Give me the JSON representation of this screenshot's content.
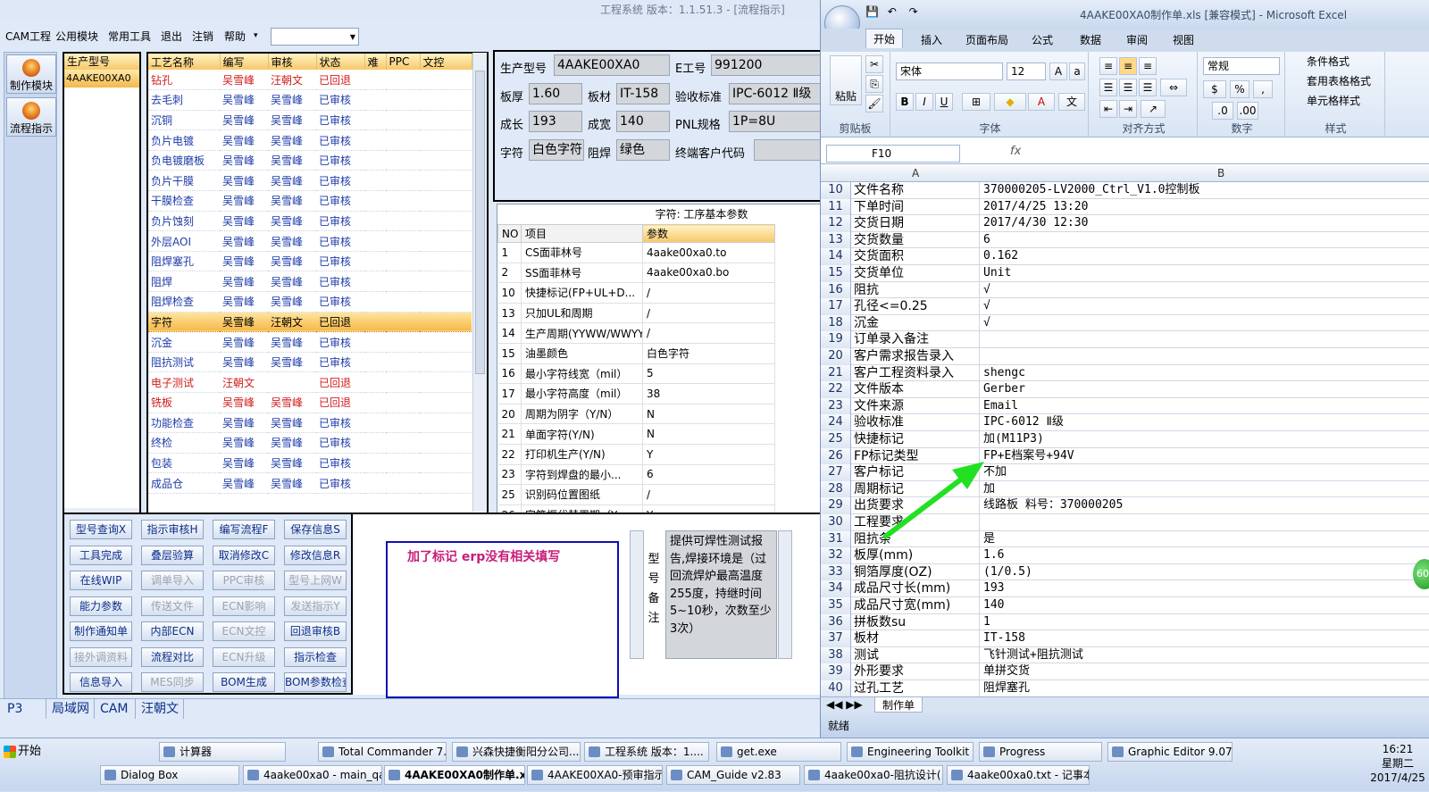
{
  "app": {
    "title": "工程系统  版本：1.1.51.3 - [流程指示]",
    "menu": [
      "CAM工程",
      "公用模块",
      "常用工具",
      "退出",
      "注销",
      "帮助"
    ],
    "menu_overflow": "▾",
    "left_buttons": [
      "制作模块",
      "流程指示"
    ]
  },
  "model_list": {
    "header": "生产型号",
    "items": [
      "4AAKE00XA0"
    ]
  },
  "process_table": {
    "columns": [
      "工艺名称",
      "编写",
      "审核",
      "状态",
      "难",
      "PPC",
      "文控"
    ],
    "rows": [
      {
        "name": "钻孔",
        "writer": "吴雪峰",
        "reviewer": "汪朝文",
        "status": "已回退",
        "color": "red"
      },
      {
        "name": "去毛刺",
        "writer": "吴雪峰",
        "reviewer": "吴雪峰",
        "status": "已审核",
        "color": "blue"
      },
      {
        "name": "沉铜",
        "writer": "吴雪峰",
        "reviewer": "吴雪峰",
        "status": "已审核",
        "color": "blue"
      },
      {
        "name": "负片电镀",
        "writer": "吴雪峰",
        "reviewer": "吴雪峰",
        "status": "已审核",
        "color": "blue"
      },
      {
        "name": "负电镀磨板",
        "writer": "吴雪峰",
        "reviewer": "吴雪峰",
        "status": "已审核",
        "color": "blue"
      },
      {
        "name": "负片干膜",
        "writer": "吴雪峰",
        "reviewer": "吴雪峰",
        "status": "已审核",
        "color": "blue"
      },
      {
        "name": "干膜检查",
        "writer": "吴雪峰",
        "reviewer": "吴雪峰",
        "status": "已审核",
        "color": "blue"
      },
      {
        "name": "负片蚀刻",
        "writer": "吴雪峰",
        "reviewer": "吴雪峰",
        "status": "已审核",
        "color": "blue"
      },
      {
        "name": "外层AOI",
        "writer": "吴雪峰",
        "reviewer": "吴雪峰",
        "status": "已审核",
        "color": "blue"
      },
      {
        "name": "阻焊塞孔",
        "writer": "吴雪峰",
        "reviewer": "吴雪峰",
        "status": "已审核",
        "color": "blue"
      },
      {
        "name": "阻焊",
        "writer": "吴雪峰",
        "reviewer": "吴雪峰",
        "status": "已审核",
        "color": "blue"
      },
      {
        "name": "阻焊检查",
        "writer": "吴雪峰",
        "reviewer": "吴雪峰",
        "status": "已审核",
        "color": "blue"
      },
      {
        "name": "字符",
        "writer": "吴雪峰",
        "reviewer": "汪朝文",
        "status": "已回退",
        "color": "black",
        "selected": true
      },
      {
        "name": "沉金",
        "writer": "吴雪峰",
        "reviewer": "吴雪峰",
        "status": "已审核",
        "color": "blue"
      },
      {
        "name": "阻抗测试",
        "writer": "吴雪峰",
        "reviewer": "吴雪峰",
        "status": "已审核",
        "color": "blue"
      },
      {
        "name": "电子测试",
        "writer": "汪朝文",
        "reviewer": "",
        "status": "已回退",
        "color": "red"
      },
      {
        "name": "铣板",
        "writer": "吴雪峰",
        "reviewer": "吴雪峰",
        "status": "已回退",
        "color": "red"
      },
      {
        "name": "功能检查",
        "writer": "吴雪峰",
        "reviewer": "吴雪峰",
        "status": "已审核",
        "color": "blue"
      },
      {
        "name": "终检",
        "writer": "吴雪峰",
        "reviewer": "吴雪峰",
        "status": "已审核",
        "color": "blue"
      },
      {
        "name": "包装",
        "writer": "吴雪峰",
        "reviewer": "吴雪峰",
        "status": "已审核",
        "color": "blue"
      },
      {
        "name": "成品仓",
        "writer": "吴雪峰",
        "reviewer": "吴雪峰",
        "status": "已审核",
        "color": "blue"
      }
    ]
  },
  "info": {
    "model_label": "生产型号",
    "model_value": "4AAKE00XA0",
    "eng_label": "E工号",
    "eng_value": "991200",
    "thickness_label": "板厚",
    "thickness_value": "1.60",
    "material_label": "板材",
    "material_value": "IT-158",
    "standard_label": "验收标准",
    "standard_value": "IPC-6012 Ⅱ级",
    "length_label": "成长",
    "length_value": "193",
    "width_label": "成宽",
    "width_value": "140",
    "pnl_label": "PNL规格",
    "pnl_value": "1P=8U",
    "char_label": "字符",
    "char_value": "白色字符",
    "mask_label": "阻焊",
    "mask_value": "绿色",
    "customer_label": "终端客户代码",
    "customer_value": ""
  },
  "params": {
    "title": "字符: 工序基本参数",
    "columns": [
      "NO",
      "项目",
      "参数"
    ],
    "rows": [
      {
        "no": "1",
        "item": "CS面菲林号",
        "value": "4aake00xa0.to"
      },
      {
        "no": "2",
        "item": "SS面菲林号",
        "value": "4aake00xa0.bo"
      },
      {
        "no": "10",
        "item": "快捷标记(FP+UL+D...",
        "value": "/"
      },
      {
        "no": "13",
        "item": "只加UL和周期",
        "value": "/"
      },
      {
        "no": "14",
        "item": "生产周期(YYWW/WWYY)",
        "value": "/"
      },
      {
        "no": "15",
        "item": "油墨颜色",
        "value": "白色字符"
      },
      {
        "no": "16",
        "item": "最小字符线宽（mil）",
        "value": "5"
      },
      {
        "no": "17",
        "item": "最小字符高度（mil）",
        "value": "38"
      },
      {
        "no": "20",
        "item": "周期为阴字（Y/N）",
        "value": "N"
      },
      {
        "no": "21",
        "item": "单面字符(Y/N)",
        "value": "N"
      },
      {
        "no": "22",
        "item": "打印机生产(Y/N)",
        "value": "Y"
      },
      {
        "no": "23",
        "item": "字符到焊盘的最小...",
        "value": "6"
      },
      {
        "no": "25",
        "item": "识别码位置图纸",
        "value": "/"
      },
      {
        "no": "26",
        "item": "字符框代替周期（Y...",
        "value": "Y"
      }
    ]
  },
  "function_buttons": [
    {
      "label": "型号查询X",
      "enabled": true
    },
    {
      "label": "指示审核H",
      "enabled": true
    },
    {
      "label": "编写流程F",
      "enabled": true
    },
    {
      "label": "保存信息S",
      "enabled": true
    },
    {
      "label": "工具完成",
      "enabled": true
    },
    {
      "label": "叠层验算",
      "enabled": true
    },
    {
      "label": "取消修改C",
      "enabled": true
    },
    {
      "label": "修改信息R",
      "enabled": true
    },
    {
      "label": "在线WIP",
      "enabled": true
    },
    {
      "label": "调单导入",
      "enabled": false
    },
    {
      "label": "PPC审核",
      "enabled": false
    },
    {
      "label": "型号上网W",
      "enabled": false
    },
    {
      "label": "能力参数",
      "enabled": true
    },
    {
      "label": "传送文件",
      "enabled": false
    },
    {
      "label": "ECN影响",
      "enabled": false
    },
    {
      "label": "发送指示Y",
      "enabled": false
    },
    {
      "label": "制作通知单",
      "enabled": true
    },
    {
      "label": "内部ECN",
      "enabled": true
    },
    {
      "label": "ECN文控",
      "enabled": false
    },
    {
      "label": "回退审核B",
      "enabled": true
    },
    {
      "label": "接外调资料",
      "enabled": false
    },
    {
      "label": "流程对比",
      "enabled": true
    },
    {
      "label": "ECN升级",
      "enabled": false
    },
    {
      "label": "指示检查",
      "enabled": true
    },
    {
      "label": "信息导入",
      "enabled": true
    },
    {
      "label": "MES同步",
      "enabled": false
    },
    {
      "label": "BOM生成",
      "enabled": true
    },
    {
      "label": "BOM参数检查",
      "enabled": true
    }
  ],
  "note": "加了标记  erp没有相关填写",
  "remark": {
    "label": "型号备注",
    "text": "提供可焊性测试报告,焊接环境是（过回流焊炉最高温度255度，持继时间5~10秒，次数至少3次）"
  },
  "status_items": [
    "P3",
    "局域网",
    "CAM",
    "汪朝文"
  ],
  "excel": {
    "title": "4AAKE00XA0制作单.xls [兼容模式] - Microsoft Excel",
    "tabs": [
      "开始",
      "插入",
      "页面布局",
      "公式",
      "数据",
      "审阅",
      "视图"
    ],
    "font_name": "宋体",
    "font_size": "12",
    "number_format": "常规",
    "group_labels": [
      "剪贴板",
      "字体",
      "对齐方式",
      "数字",
      "样式"
    ],
    "style_buttons": [
      "条件格式",
      "套用表格格式",
      "单元格样式"
    ],
    "paste_label": "粘贴",
    "name_box": "F10",
    "fx": "fx",
    "col_a": "A",
    "col_b": "B",
    "sheet_tab": "制作单",
    "status": "就绪",
    "rows": [
      {
        "n": "10",
        "a": "文件名称",
        "b": "370000205-LV2000_Ctrl_V1.0控制板"
      },
      {
        "n": "11",
        "a": "下单时间",
        "b": "2017/4/25 13:20"
      },
      {
        "n": "12",
        "a": "交货日期",
        "b": "2017/4/30 12:30"
      },
      {
        "n": "13",
        "a": "交货数量",
        "b": "6"
      },
      {
        "n": "14",
        "a": "交货面积",
        "b": "0.162"
      },
      {
        "n": "15",
        "a": "交货单位",
        "b": "Unit"
      },
      {
        "n": "16",
        "a": "阻抗",
        "b": "√"
      },
      {
        "n": "17",
        "a": "孔径<=0.25",
        "b": "√"
      },
      {
        "n": "18",
        "a": "沉金",
        "b": "√"
      },
      {
        "n": "19",
        "a": "订单录入备注",
        "b": ""
      },
      {
        "n": "20",
        "a": "客户需求报告录入",
        "b": ""
      },
      {
        "n": "21",
        "a": "客户工程资料录入",
        "b": "shengc"
      },
      {
        "n": "22",
        "a": "文件版本",
        "b": "Gerber"
      },
      {
        "n": "23",
        "a": "文件来源",
        "b": "Email"
      },
      {
        "n": "24",
        "a": "验收标准",
        "b": "IPC-6012 Ⅱ级"
      },
      {
        "n": "25",
        "a": "快捷标记",
        "b": "加(M11P3)"
      },
      {
        "n": "26",
        "a": "FP标记类型",
        "b": "FP+E档案号+94V"
      },
      {
        "n": "27",
        "a": "客户标记",
        "b": "不加"
      },
      {
        "n": "28",
        "a": "周期标记",
        "b": "加"
      },
      {
        "n": "29",
        "a": "出货要求",
        "b": "线路板 料号：370000205"
      },
      {
        "n": "30",
        "a": "工程要求",
        "b": ""
      },
      {
        "n": "31",
        "a": "阻抗条",
        "b": "是"
      },
      {
        "n": "32",
        "a": "板厚(mm)",
        "b": "1.6"
      },
      {
        "n": "33",
        "a": "铜箔厚度(OZ)",
        "b": "(1/0.5)"
      },
      {
        "n": "34",
        "a": "成品尺寸长(mm)",
        "b": "193"
      },
      {
        "n": "35",
        "a": "成品尺寸宽(mm)",
        "b": "140"
      },
      {
        "n": "36",
        "a": "拼板数su",
        "b": "1"
      },
      {
        "n": "37",
        "a": "板材",
        "b": "IT-158"
      },
      {
        "n": "38",
        "a": "测试",
        "b": "飞针测试+阻抗测试"
      },
      {
        "n": "39",
        "a": "外形要求",
        "b": "单拼交货"
      },
      {
        "n": "40",
        "a": "过孔工艺",
        "b": "阻焊塞孔"
      }
    ]
  },
  "badge": "60",
  "taskbar": {
    "start": "开始",
    "row1": [
      "计算器",
      "Total Commander 7.0 ...",
      "兴森快捷衡阳分公司...",
      "工程系统  版本：1....",
      "get.exe",
      "Engineering Toolkit 9....",
      "Progress",
      "Graphic Editor 9.07b2 ..."
    ],
    "row2": [
      "Dialog Box",
      "4aake00xa0 - main_qa",
      "4AAKE00XA0制作单.x...",
      "4AAKE00XA0-预审指示....",
      "CAM_Guide v2.83",
      "4aake00xa0-阻抗设计(...",
      "4aake00xa0.txt - 记事本"
    ],
    "time": "16:21",
    "weekday": "星期二",
    "date": "2017/4/25"
  }
}
